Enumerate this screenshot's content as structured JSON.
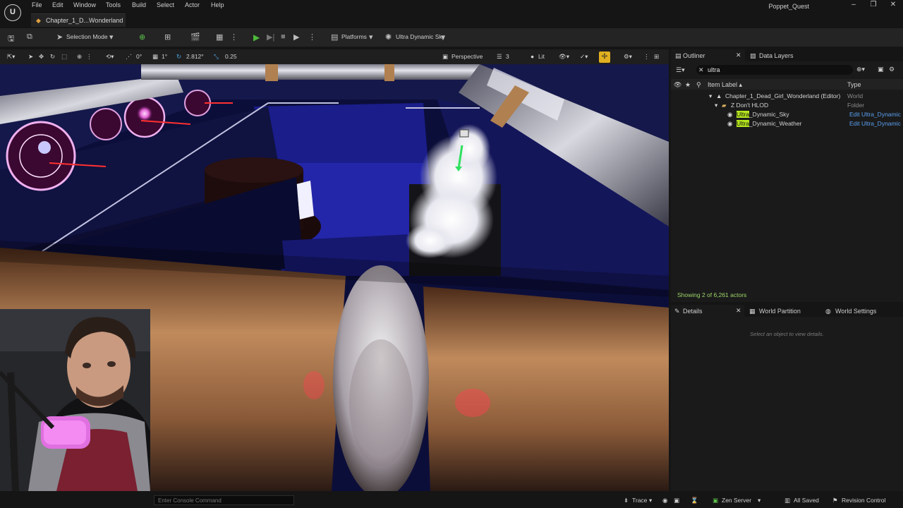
{
  "app": {
    "logo_glyph": "U",
    "project_name": "Poppet_Quest",
    "window_controls": [
      "–",
      "❐",
      "✕"
    ]
  },
  "menu": [
    "File",
    "Edit",
    "Window",
    "Tools",
    "Build",
    "Select",
    "Actor",
    "Help"
  ],
  "level_tab": {
    "label": "Chapter_1_D...Wonderland",
    "icon": "level-icon"
  },
  "toolbar": {
    "selection_mode": "Selection Mode",
    "platforms": "Platforms",
    "sky_label": "Ultra Dynamic Sky",
    "play_state": "stopped"
  },
  "viewport_toolbar": {
    "rotation_snap": "0°",
    "grid_snap": "1°",
    "camera_speed": "2.812°",
    "scale_snap": "0.25",
    "view_mode_perspective": "Perspective",
    "layer_count": "3",
    "lighting": "Lit"
  },
  "outliner": {
    "tab_label": "Outliner",
    "data_layers_tab": "Data Layers",
    "search_value": "ultra",
    "col_item_label": "Item Label ▴",
    "col_type": "Type",
    "rows": [
      {
        "label": "Chapter_1_Dead_Girl_Wonderland (Editor)",
        "type": "World",
        "indent": 0
      },
      {
        "label": "Z Don't HLOD",
        "type": "Folder",
        "indent": 1
      },
      {
        "label_hl": "Ultra",
        "label_rest": "_Dynamic_Sky",
        "type": "Edit Ultra_Dynamic",
        "indent": 2
      },
      {
        "label_hl": "Ultra",
        "label_rest": "_Dynamic_Weather",
        "type": "Edit Ultra_Dynamic",
        "indent": 2
      }
    ],
    "actor_count": "Showing 2 of 6,261 actors"
  },
  "details": {
    "tab_label": "Details",
    "world_partition_tab": "World Partition",
    "world_settings_tab": "World Settings",
    "hint": "Select an object to view details."
  },
  "statusbar": {
    "console_placeholder": "Enter Console Command",
    "trace": "Trace",
    "zen_server": "Zen Server",
    "all_saved": "All Saved",
    "revision_control": "Revision Control"
  },
  "colors": {
    "accent_green": "#4dba3a",
    "highlight": "#b5e61d",
    "link_blue": "#5aa0f0",
    "snap_yellow": "#e0b020"
  }
}
